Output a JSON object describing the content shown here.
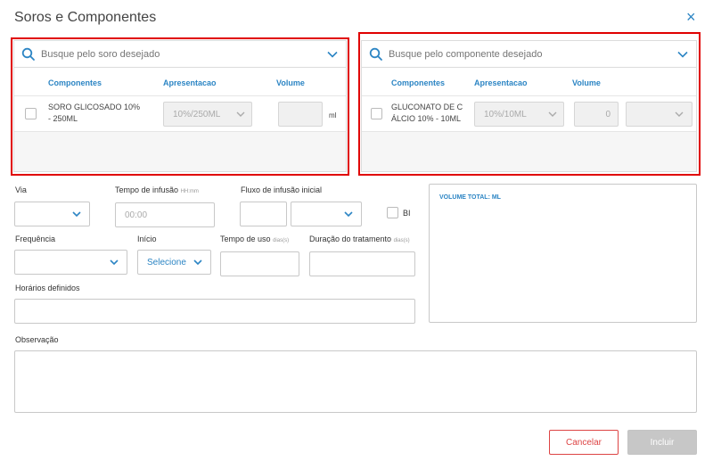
{
  "dialog": {
    "title": "Soros e Componentes",
    "close": "×"
  },
  "soro_panel": {
    "search_placeholder": "Busque pelo soro desejado",
    "headers": {
      "componentes": "Componentes",
      "apresentacao": "Apresentacao",
      "volume": "Volume"
    },
    "row": {
      "name_line1": "SORO GLICOSADO 10%",
      "name_line2": "- 250ML",
      "apresentacao": "10%/250ML",
      "volume": "",
      "unit": "ml"
    }
  },
  "componente_panel": {
    "search_placeholder": "Busque pelo componente desejado",
    "headers": {
      "componentes": "Componentes",
      "apresentacao": "Apresentacao",
      "volume": "Volume"
    },
    "row": {
      "name_line1": "GLUCONATO DE C",
      "name_line2": "ÁLCIO 10% - 10ML",
      "apresentacao": "10%/10ML",
      "volume": "0",
      "unit": ""
    }
  },
  "form": {
    "via_label": "Via",
    "tempo_infusao_label": "Tempo de infusão",
    "tempo_infusao_sub": "HH:mm",
    "tempo_infusao_placeholder": "00:00",
    "fluxo_label": "Fluxo de infusão inicial",
    "bi_label": "BI",
    "frequencia_label": "Frequência",
    "inicio_label": "Início",
    "inicio_value": "Selecione",
    "tempo_uso_label": "Tempo de uso",
    "tempo_uso_sub": "dias(s)",
    "duracao_label": "Duração do tratamento",
    "duracao_sub": "dias(s)",
    "horarios_label": "Horários definidos",
    "observacao_label": "Observação",
    "volume_total": "VOLUME TOTAL: ML"
  },
  "buttons": {
    "cancel": "Cancelar",
    "include": "Incluir"
  },
  "colors": {
    "accent": "#2c85c4",
    "highlight": "#e00000",
    "cancel": "#dd4444"
  }
}
